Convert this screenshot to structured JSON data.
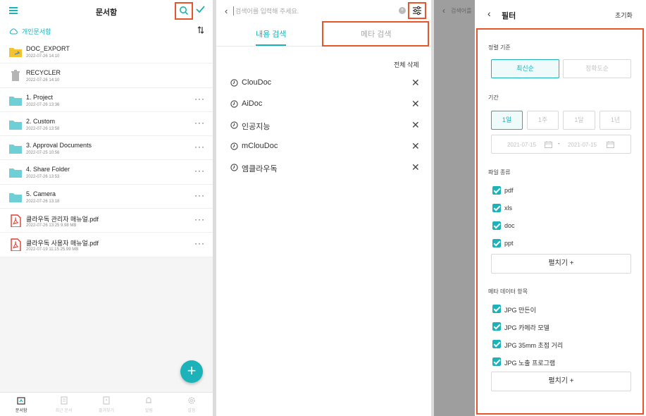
{
  "screen1": {
    "title": "문서함",
    "location": "개인문서함",
    "sort_icon": "sort-arrows-icon",
    "files": [
      {
        "name": "DOC_EXPORT",
        "meta": "2022-07-26 14:10",
        "icon": "folder-export-icon",
        "more": false
      },
      {
        "name": "RECYCLER",
        "meta": "2022-07-26 14:10",
        "icon": "trash-icon",
        "more": false
      },
      {
        "name": "1. Project",
        "meta": "2022-07-26 13:36",
        "icon": "folder-icon",
        "more": true
      },
      {
        "name": "2. Custom",
        "meta": "2022-07-26 13:58",
        "icon": "folder-icon",
        "more": true
      },
      {
        "name": "3. Approval Documents",
        "meta": "2022-07-25 10:56",
        "icon": "folder-icon",
        "more": true
      },
      {
        "name": "4. Share Folder",
        "meta": "2022-07-26 13:53",
        "icon": "folder-icon",
        "more": true
      },
      {
        "name": "5. Camera",
        "meta": "2022-07-26 13:18",
        "icon": "folder-icon",
        "more": true
      },
      {
        "name": "클라우독 관리자 매뉴얼.pdf",
        "meta": "2022-07-26 13:25    9.98 MB",
        "icon": "pdf-icon",
        "more": true
      },
      {
        "name": "클라우독 사용자 매뉴얼.pdf",
        "meta": "2022-07-19 11:15    25.99 MB",
        "icon": "pdf-icon",
        "more": true
      }
    ],
    "more_label": "···",
    "fab_label": "+",
    "nav": [
      {
        "label": "문서함",
        "icon": "documents-icon",
        "active": true
      },
      {
        "label": "최근 문서",
        "icon": "recent-docs-icon",
        "active": false
      },
      {
        "label": "즐겨찾기",
        "icon": "favorites-icon",
        "active": false
      },
      {
        "label": "알림",
        "icon": "bell-icon",
        "active": false
      },
      {
        "label": "설정",
        "icon": "settings-icon",
        "active": false
      }
    ]
  },
  "screen2": {
    "placeholder": "검색어를 입력해 주세요.",
    "tabs": [
      {
        "label": "내용 검색",
        "active": true
      },
      {
        "label": "메타 검색",
        "active": false
      }
    ],
    "clear_all": "전체 삭제",
    "history": [
      "ClouDoc",
      "AiDoc",
      "인공지능",
      "mClouDoc",
      "엠클라우독"
    ],
    "remove_label": "✕"
  },
  "screen3": {
    "dim_search_placeholder": "검색어를",
    "title": "필터",
    "reset": "초기화",
    "sort_label": "정렬 기준",
    "sort_options": [
      {
        "label": "최신순",
        "selected": true
      },
      {
        "label": "정확도순",
        "selected": false
      }
    ],
    "period_label": "기간",
    "period_options": [
      {
        "label": "1일",
        "selected": true
      },
      {
        "label": "1주",
        "selected": false
      },
      {
        "label": "1달",
        "selected": false
      },
      {
        "label": "1년",
        "selected": false
      }
    ],
    "date_from": "2021-07-15",
    "date_sep": "-",
    "date_to": "2021-07-15",
    "file_type_label": "파일 종류",
    "file_types": [
      "pdf",
      "xls",
      "doc",
      "ppt"
    ],
    "expand_label": "펼치기 +",
    "meta_label": "메타 데이터 항목",
    "meta_items": [
      "JPG 만든이",
      "JPG 카메라 모델",
      "JPG 35mm 초점 거리",
      "JPG 노출 프로그램"
    ],
    "expand_label2": "펼치기 +"
  },
  "colors": {
    "accent": "#1bb3b9",
    "highlight": "#e8552b",
    "folder": "#6fcfd6",
    "pdf": "#e23b2e"
  }
}
